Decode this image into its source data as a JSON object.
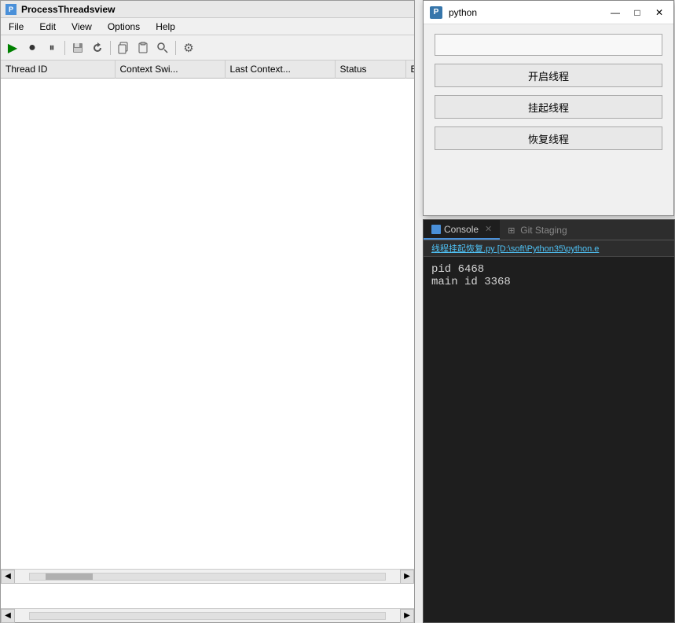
{
  "mainWindow": {
    "title": "ProcessThreadsview",
    "icon": "P",
    "menu": [
      "File",
      "Edit",
      "View",
      "Options",
      "Help"
    ],
    "toolbar": {
      "buttons": [
        {
          "name": "play",
          "icon": "▶",
          "label": "Run"
        },
        {
          "name": "stop",
          "icon": "●",
          "label": "Stop"
        },
        {
          "name": "pause",
          "icon": "⏸",
          "label": "Pause"
        },
        {
          "name": "save",
          "icon": "💾",
          "label": "Save"
        },
        {
          "name": "refresh",
          "icon": "↻",
          "label": "Refresh"
        },
        {
          "name": "copy",
          "icon": "⎘",
          "label": "Copy"
        },
        {
          "name": "paste",
          "icon": "📋",
          "label": "Paste"
        },
        {
          "name": "find",
          "icon": "🔍",
          "label": "Find"
        },
        {
          "name": "settings",
          "icon": "⚙",
          "label": "Settings"
        }
      ]
    },
    "table": {
      "columns": [
        "Thread ID",
        "Context Swi...",
        "Last Context...",
        "Status",
        "Ba"
      ]
    }
  },
  "pythonWindow": {
    "title": "python",
    "icon": "🐍",
    "input_placeholder": "",
    "buttons": {
      "start": "开启线程",
      "suspend": "挂起线程",
      "resume": "恢复线程"
    },
    "windowControls": {
      "minimize": "—",
      "maximize": "□",
      "close": "✕"
    }
  },
  "consolePanel": {
    "tabs": [
      {
        "label": "Console",
        "active": true
      },
      {
        "label": "Git Staging",
        "active": false
      }
    ],
    "filepath": "线程挂起恢复.py [D:\\soft\\Python35\\python.e",
    "output": "pid 6468\nmain id 3368"
  }
}
